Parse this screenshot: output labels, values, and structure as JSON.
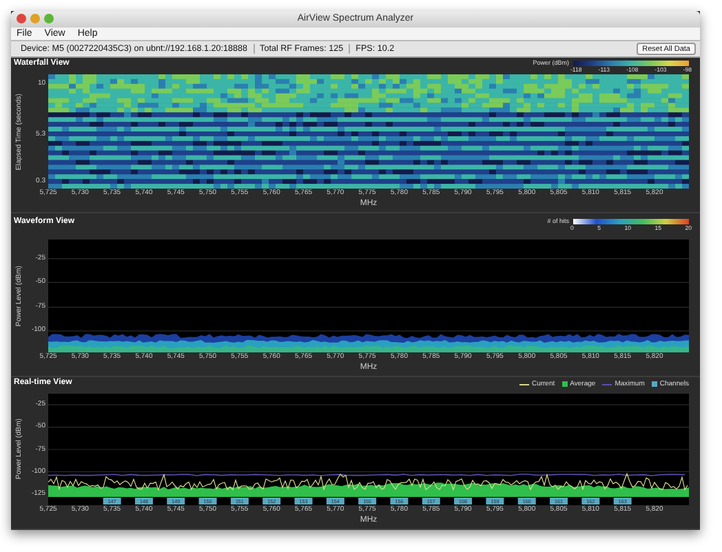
{
  "window": {
    "title": "AirView Spectrum Analyzer"
  },
  "menu": [
    "File",
    "View",
    "Help"
  ],
  "status_bar": {
    "device": "Device: M5 (0027220435C3) on ubnt://192.168.1.20:18888",
    "frames": "Total RF Frames: 125",
    "fps": "FPS: 10.2",
    "reset_button": "Reset All Data"
  },
  "panels": [
    {
      "kind": "waterfall",
      "title": "Waterfall View",
      "legend_title": "Power (dBm)",
      "legend_ticks": [
        "-118",
        "-113",
        "-108",
        "-103",
        "-98"
      ],
      "ylabel": "Elapsed Time (seconds)",
      "yticks": [
        "10",
        "5.3",
        "0.3"
      ],
      "xticks": [
        "5,725",
        "5,730",
        "5,735",
        "5,740",
        "5,745",
        "5,750",
        "5,755",
        "5,760",
        "5,765",
        "5,770",
        "5,775",
        "5,780",
        "5,785",
        "5,790",
        "5,795",
        "5,800",
        "5,805",
        "5,810",
        "5,815",
        "5,820"
      ],
      "xlabel": "MHz"
    },
    {
      "kind": "waveform",
      "title": "Waveform View",
      "legend_title": "# of hits",
      "legend_ticks": [
        "0",
        "5",
        "10",
        "15",
        "20"
      ],
      "ylabel": "Power Level (dBm)",
      "yticks": [
        "-25",
        "-50",
        "-75",
        "-100"
      ],
      "xticks": [
        "5,725",
        "5,730",
        "5,735",
        "5,740",
        "5,745",
        "5,750",
        "5,755",
        "5,760",
        "5,765",
        "5,770",
        "5,775",
        "5,780",
        "5,785",
        "5,790",
        "5,795",
        "5,800",
        "5,805",
        "5,810",
        "5,815",
        "5,820"
      ],
      "xlabel": "MHz"
    },
    {
      "kind": "realtime",
      "title": "Real-time View",
      "legend": [
        {
          "label": "Current",
          "kind": "line",
          "color": "#d8d890"
        },
        {
          "label": "Average",
          "kind": "square",
          "color": "#2fbf4a"
        },
        {
          "label": "Maximum",
          "kind": "line",
          "color": "#5a50b0"
        },
        {
          "label": "Channels",
          "kind": "square",
          "color": "#5aa8c0"
        }
      ],
      "ylabel": "Power Level (dBm)",
      "yticks": [
        "-25",
        "-50",
        "-75",
        "-100",
        "-125"
      ],
      "channels": [
        "147",
        "148",
        "149",
        "150",
        "151",
        "152",
        "153",
        "154",
        "155",
        "156",
        "157",
        "158",
        "159",
        "160",
        "161",
        "162",
        "163"
      ],
      "xticks": [
        "5,725",
        "5,730",
        "5,735",
        "5,740",
        "5,745",
        "5,750",
        "5,755",
        "5,760",
        "5,765",
        "5,770",
        "5,775",
        "5,780",
        "5,785",
        "5,790",
        "5,795",
        "5,800",
        "5,805",
        "5,810",
        "5,815",
        "5,820"
      ],
      "xlabel": "MHz"
    }
  ]
}
